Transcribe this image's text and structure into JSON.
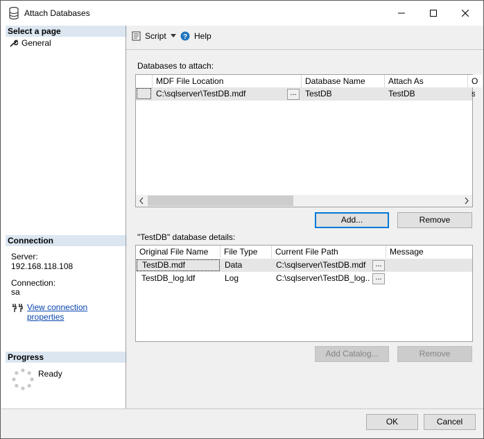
{
  "window": {
    "title": "Attach Databases"
  },
  "sidebar": {
    "select_page_header": "Select a page",
    "pages": [
      {
        "label": "General"
      }
    ],
    "connection_header": "Connection",
    "server_label": "Server:",
    "server_value": "192.168.118.108",
    "connection_label": "Connection:",
    "connection_value": "sa",
    "view_connection_link": "View connection properties",
    "progress_header": "Progress",
    "progress_status": "Ready"
  },
  "toolbar": {
    "script_label": "Script",
    "help_label": "Help"
  },
  "databases": {
    "section_label": "Databases to attach:",
    "columns": [
      "MDF File Location",
      "Database Name",
      "Attach As",
      "O"
    ],
    "rows": [
      {
        "mdf": "C:\\sqlserver\\TestDB.mdf",
        "ellipsis": "...",
        "name": "TestDB",
        "attach_as": "TestDB",
        "owner": "s"
      }
    ],
    "add_label": "Add...",
    "remove_label": "Remove"
  },
  "details": {
    "section_label": "\"TestDB\" database details:",
    "columns": [
      "Original File Name",
      "File Type",
      "Current File Path",
      "Message"
    ],
    "rows": [
      {
        "original": "TestDB.mdf",
        "type": "Data",
        "path": "C:\\sqlserver\\TestDB.mdf",
        "ellipsis": "..."
      },
      {
        "original": "TestDB_log.ldf",
        "type": "Log",
        "path": "C:\\sqlserver\\TestDB_log....",
        "ellipsis": "..."
      }
    ],
    "add_catalog_label": "Add Catalog...",
    "remove_label": "Remove"
  },
  "footer": {
    "ok_label": "OK",
    "cancel_label": "Cancel"
  },
  "colors": {
    "accent": "#0078d7",
    "section_header": "#dbe6f1",
    "link": "#0645ad",
    "selected_row": "#e6e6e6"
  }
}
